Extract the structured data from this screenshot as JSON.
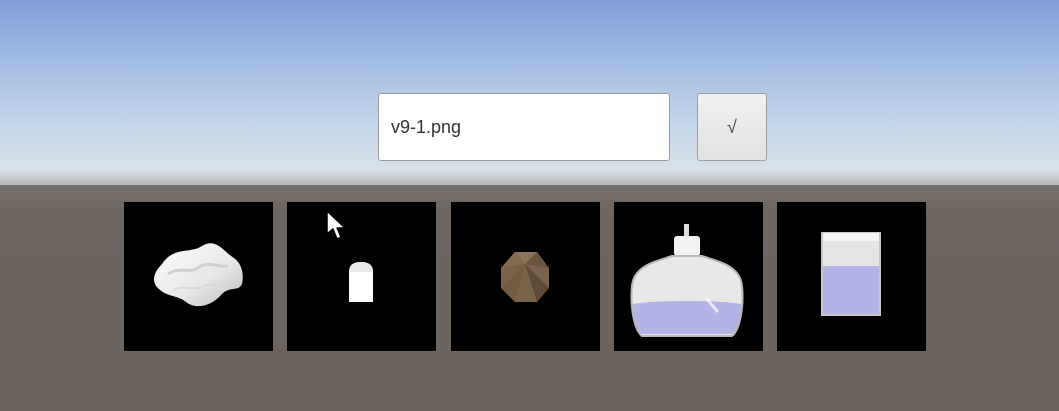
{
  "filename_input": {
    "value": "v9-1.png"
  },
  "confirm_button": {
    "label": "√"
  },
  "thumbnails": [
    {
      "name": "cloth",
      "icon": "cloth-icon"
    },
    {
      "name": "capsule",
      "icon": "capsule-icon"
    },
    {
      "name": "polyhedron",
      "icon": "polyhedron-icon"
    },
    {
      "name": "flask",
      "icon": "flask-icon"
    },
    {
      "name": "beaker",
      "icon": "beaker-icon"
    }
  ],
  "colors": {
    "sky_top": "#7f9fd6",
    "horizon": "#d8e2ea",
    "ground": "#6b635d",
    "liquid": "#b3b3e6",
    "polyhedron": "#7b624b"
  }
}
